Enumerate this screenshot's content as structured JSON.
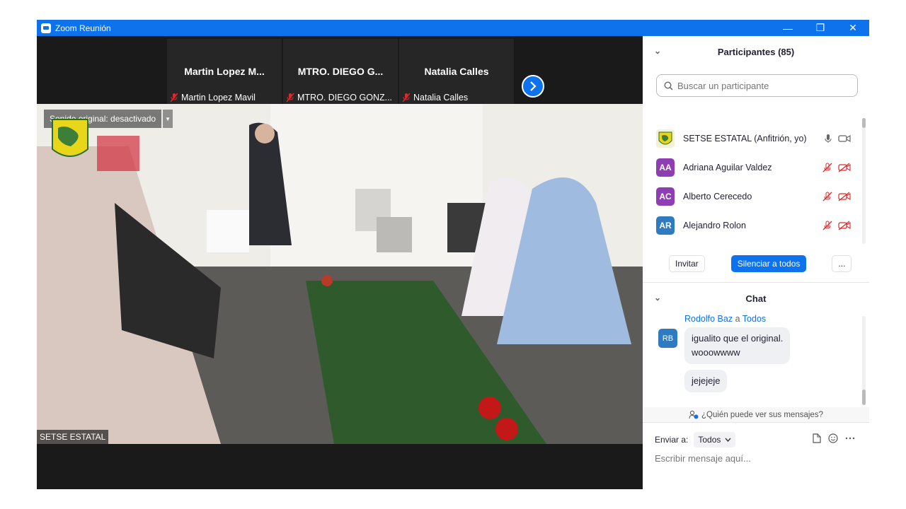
{
  "window": {
    "title": "Zoom Reunión",
    "controls": {
      "minimize": "—",
      "restore": "❐",
      "close": "✕"
    }
  },
  "thumbnails": [
    {
      "display_name": "Martin  Lopez  M...",
      "label": "Martin Lopez Mavil"
    },
    {
      "display_name": "MTRO. DIEGO G...",
      "label": "MTRO. DIEGO GONZ..."
    },
    {
      "display_name": "Natalia Calles",
      "label": "Natalia Calles"
    }
  ],
  "main_video": {
    "original_sound": "Sonido original: desactivado",
    "speaker_name": "SETSE ESTATAL"
  },
  "participants": {
    "header": "Participantes (85)",
    "search_placeholder": "Buscar un participante",
    "list": [
      {
        "initials": "",
        "name": "SETSE ESTATAL (Anfitrión, yo)",
        "color": "#6a8f3a",
        "muted": false
      },
      {
        "initials": "AA",
        "name": "Adriana Aguilar Valdez",
        "color": "#8f3db3",
        "muted": true
      },
      {
        "initials": "AC",
        "name": "Alberto Cerecedo",
        "color": "#8f3db3",
        "muted": true
      },
      {
        "initials": "AR",
        "name": "Alejandro Rolon",
        "color": "#2f7bc1",
        "muted": true
      }
    ],
    "buttons": {
      "invite": "Invitar",
      "mute_all": "Silenciar a todos",
      "more": "..."
    }
  },
  "chat": {
    "header": "Chat",
    "message": {
      "sender": "Rodolfo Baz",
      "connector": "a",
      "recipient": "Todos",
      "avatar": "RB",
      "lines": [
        "igualito que el original.\nwooowwww",
        "jejejeje"
      ]
    },
    "who_can_see": "¿Quién puede ver sus mensajes?",
    "send_to_label": "Enviar a:",
    "send_to_value": "Todos",
    "compose_placeholder": "Escribir mensaje aquí..."
  },
  "colors": {
    "accent": "#0e72ed",
    "title_bar": "#0e72ed",
    "mute_red": "#e02828"
  }
}
